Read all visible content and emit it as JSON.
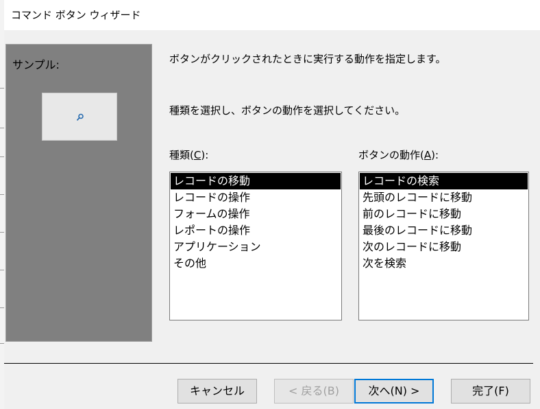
{
  "window": {
    "title": "コマンド ボタン ウィザード"
  },
  "sample": {
    "label": "サンプル:",
    "icon": "search-icon"
  },
  "instructions": {
    "line1": "ボタンがクリックされたときに実行する動作を指定します。",
    "line2": "種類を選択し、ボタンの動作を選択してください。"
  },
  "categories": {
    "label_prefix": "種類(",
    "label_key": "C",
    "label_suffix": "):",
    "items": [
      "レコードの移動",
      "レコードの操作",
      "フォームの操作",
      "レポートの操作",
      "アプリケーション",
      "その他"
    ],
    "selected": "レコードの移動"
  },
  "actions": {
    "label_prefix": "ボタンの動作(",
    "label_key": "A",
    "label_suffix": "):",
    "items": [
      "レコードの検索",
      "先頭のレコードに移動",
      "前のレコードに移動",
      "最後のレコードに移動",
      "次のレコードに移動",
      "次を検索"
    ],
    "selected": "レコードの検索"
  },
  "buttons": {
    "cancel": "キャンセル",
    "back": "< 戻る(B)",
    "next": "次へ(N) >",
    "finish": "完了(F)"
  },
  "colors": {
    "selection": "#000000",
    "default_button_border": "#0078d7",
    "sample_panel": "#808080"
  }
}
